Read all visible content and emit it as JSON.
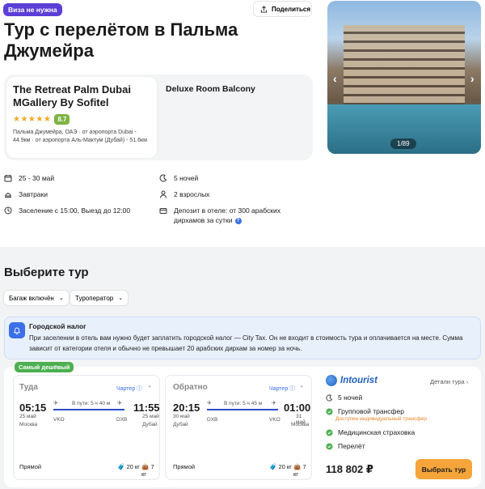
{
  "header": {
    "visa_badge": "Виза не нужна",
    "share_label": "Поделиться",
    "title": "Тур с перелётом в Пальма Джумейра"
  },
  "hotel": {
    "name": "The Retreat Palm Dubai MGallery By Sofitel",
    "stars": 5,
    "rating": "8.7",
    "location": "Пальма Джумейра, ОАЭ · от аэропорта Dubai - 44.9км · от аэропорта Аль-Мактум (Дубай) - 51.6км",
    "room_type": "Deluxe Room Balcony"
  },
  "gallery": {
    "counter": "1/89"
  },
  "trip_info": {
    "dates": "25 - 30 май",
    "nights": "5 ночей",
    "meals": "Завтраки",
    "guests": "2 взрослых",
    "checkin": "Заселение с 15:00, Выезд до 12:00",
    "deposit": "Депозит в отеле: от 300 арабских дирхамов за сутки"
  },
  "tours": {
    "section_title": "Выберите тур",
    "filters": [
      "Багаж включён",
      "Туроператор"
    ],
    "tax_notice": {
      "title": "Городской налог",
      "text": "При заселении в отель вам нужно будет заплатить городской налог — City Tax. Он не входит в стоимость тура и оплачивается на месте. Сумма зависит от категории отеля и обычно не превышает 20 арабских дирхам за номер за ночь."
    },
    "offer": {
      "badge": "Самый дешёвый",
      "outbound": {
        "label": "Туда",
        "charter": "Чартер",
        "dep_time": "05:15",
        "arr_time": "11:55",
        "duration": "В пути: 5 ч 40 м",
        "dep_date": "25 май",
        "arr_date": "25 май",
        "dep_code": "VKO",
        "arr_code": "DXB",
        "dep_city": "Москва",
        "arr_city": "Дубай",
        "stops": "Прямой",
        "baggage": "20 кг",
        "hand_luggage": "7 кг"
      },
      "return": {
        "label": "Обратно",
        "charter": "Чартер",
        "dep_time": "20:15",
        "arr_time": "01:00",
        "duration": "В пути: 5 ч 45 м",
        "dep_date": "30 май",
        "arr_date": "31 май",
        "dep_code": "DXB",
        "arr_code": "VKO",
        "dep_city": "Дубай",
        "arr_city": "Москва",
        "stops": "Прямой",
        "baggage": "20 кг",
        "hand_luggage": "7 кг"
      },
      "operator": "Intourist",
      "details_link": "Детали тура",
      "nights": "5 ночей",
      "transfer": "Групповой трансфер",
      "transfer_note": "Доступен индивидуальный трансфер",
      "insurance": "Медицинская страховка",
      "flight": "Перелёт",
      "price": "118 802 ₽",
      "choose_label": "Выбрать тур"
    }
  },
  "colors": {
    "accent": "#3b6fe8",
    "badge_purple": "#5b3fd6",
    "badge_green": "#4caf50",
    "cta_orange": "#f5a53a",
    "rating_green": "#7cb342"
  }
}
